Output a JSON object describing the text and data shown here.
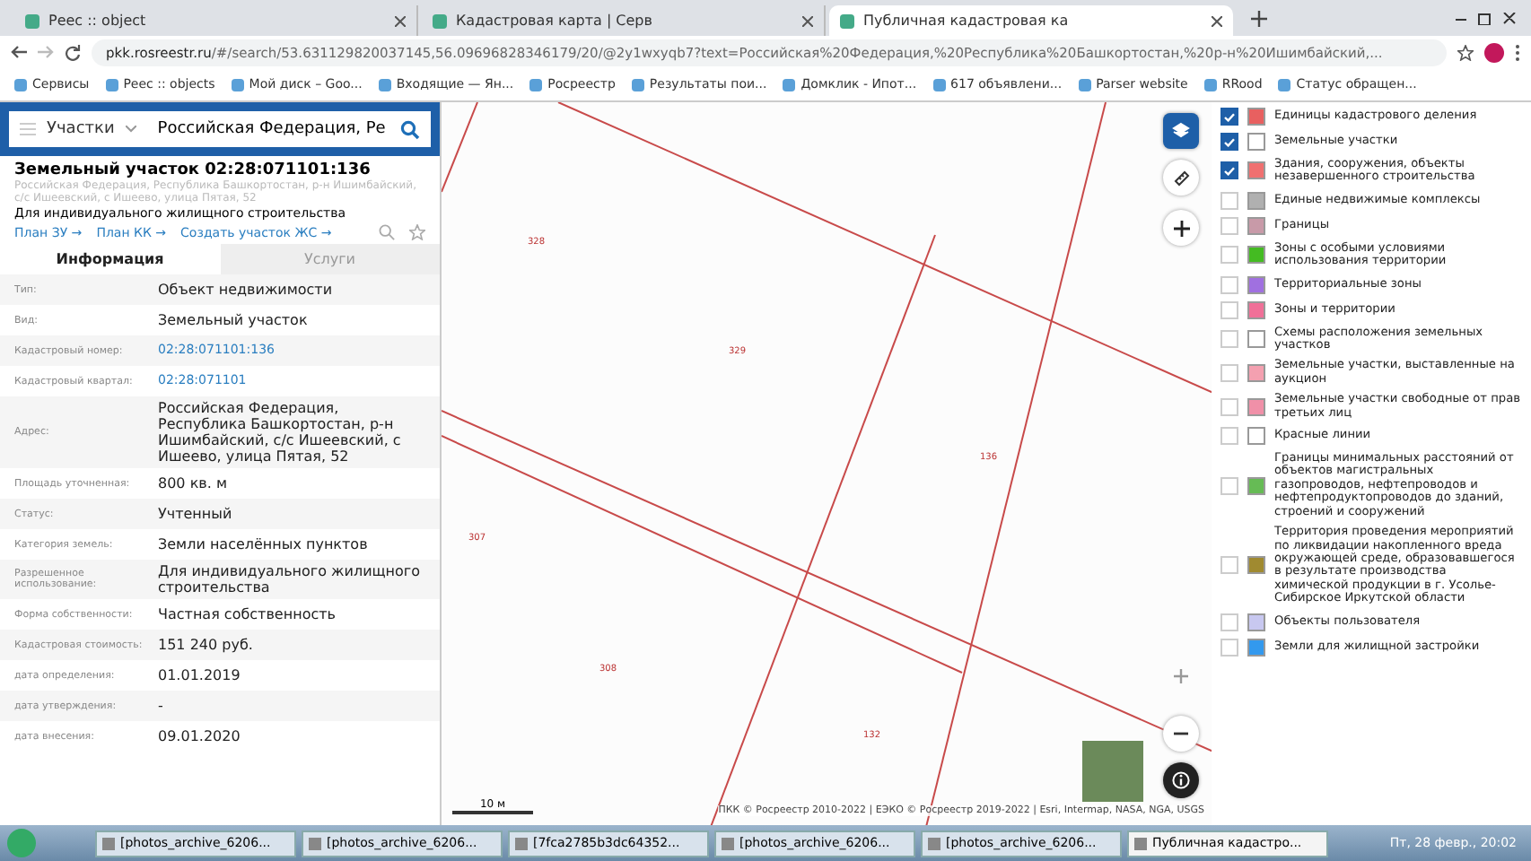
{
  "browser": {
    "tabs": [
      {
        "label": "Реес :: object",
        "selected": false
      },
      {
        "label": "Кадастровая карта | Серв",
        "selected": false
      },
      {
        "label": "Публичная кадастровая ка",
        "selected": true
      }
    ],
    "url_host": "pkk.rosreestr.ru",
    "url_path": "/#/search/53.631129820037145,56.09696828346179/20/@2y1wxyqb7?text=Российская%20Федерация,%20Республика%20Башкортостан,%20р-н%20Ишимбайский,...",
    "bookmarks": [
      "Сервисы",
      "Реес :: objects",
      "Мой диск – Goo...",
      "Входящие — Ян...",
      "Росреестр",
      "Результаты пои...",
      "Домклик - Ипот...",
      "617 объявлени...",
      "Parser website",
      "RRood",
      "Статус обращен..."
    ]
  },
  "search": {
    "category": "Участки",
    "value": "Российская Федерация, Ре"
  },
  "object": {
    "title": "Земельный участок 02:28:071101:136",
    "address": "Российская Федерация, Республика Башкортостан, р-н Ишимбайский, с/с Ишеевский, с Ишеево, улица Пятая, 52",
    "purpose": "Для индивидуального жилищного строительства",
    "links": [
      "План ЗУ →",
      "План КК →",
      "Создать участок ЖС →"
    ]
  },
  "info_tabs": [
    {
      "label": "Информация",
      "selected": true
    },
    {
      "label": "Услуги",
      "selected": false
    }
  ],
  "info_rows": [
    {
      "label": "Тип:",
      "value": "Объект недвижимости",
      "link": false
    },
    {
      "label": "Вид:",
      "value": "Земельный участок",
      "link": false
    },
    {
      "label": "Кадастровый номер:",
      "value": "02:28:071101:136",
      "link": true
    },
    {
      "label": "Кадастровый квартал:",
      "value": "02:28:071101",
      "link": true
    },
    {
      "label": "Адрес:",
      "value": "Российская Федерация, Республика Башкортостан, р-н Ишимбайский, с/с Ишеевский, с Ишеево, улица Пятая, 52",
      "link": false
    },
    {
      "label": "Площадь уточненная:",
      "value": "800 кв. м",
      "link": false
    },
    {
      "label": "Статус:",
      "value": "Учтенный",
      "link": false
    },
    {
      "label": "Категория земель:",
      "value": "Земли населённых пунктов",
      "link": false
    },
    {
      "label": "Разрешенное использование:",
      "value": "Для индивидуального жилищного строительства",
      "link": false
    },
    {
      "label": "Форма собственности:",
      "value": "Частная собственность",
      "link": false
    },
    {
      "label": "Кадастровая стоимость:",
      "value": "151 240 руб.",
      "link": false
    },
    {
      "label": "дата определения:",
      "value": "01.01.2019",
      "link": false
    },
    {
      "label": "дата утверждения:",
      "value": "-",
      "link": false
    },
    {
      "label": "дата внесения:",
      "value": "09.01.2020",
      "link": false
    }
  ],
  "map": {
    "parcels": [
      "328",
      "329",
      "136",
      "307",
      "308",
      "132"
    ],
    "scale": "10 м",
    "attribution": "ПКК © Росреестр 2010-2022 | ЕЭКО © Росреестр 2019-2022 | Esri, Intermap, NASA, NGA, USGS"
  },
  "layers": [
    {
      "label": "Единицы кадастрового деления",
      "checked": true,
      "color": "#e86060"
    },
    {
      "label": "Земельные участки",
      "checked": true,
      "color": "#ffffff"
    },
    {
      "label": "Здания, сооружения, объекты незавершенного строительства",
      "checked": true,
      "color": "#f07070"
    },
    {
      "label": "Единые недвижимые комплексы",
      "checked": false,
      "color": "#b0b0b0"
    },
    {
      "label": "Границы",
      "checked": false,
      "color": "#c89aa8"
    },
    {
      "label": "Зоны с особыми условиями использования территории",
      "checked": false,
      "color": "#44bb22"
    },
    {
      "label": "Территориальные зоны",
      "checked": false,
      "color": "#a070e0"
    },
    {
      "label": "Зоны и территории",
      "checked": false,
      "color": "#f07098"
    },
    {
      "label": "Схемы расположения земельных участков",
      "checked": false,
      "color": "#ffffff"
    },
    {
      "label": "Земельные участки, выставленные на аукцион",
      "checked": false,
      "color": "#f4a0b0"
    },
    {
      "label": "Земельные участки свободные от прав третьих лиц",
      "checked": false,
      "color": "#f090a8"
    },
    {
      "label": "Красные линии",
      "checked": false,
      "color": "#ffffff"
    },
    {
      "label": "Границы минимальных расстояний от объектов магистральных газопроводов, нефтепроводов и нефтепродуктопроводов до зданий, строений и сооружений",
      "checked": false,
      "color": "#66bb55"
    },
    {
      "label": "Территория проведения мероприятий по ликвидации накопленного вреда окружающей среде, образовавшегося в результате производства химической продукции в г. Усолье-Сибирское Иркутской области",
      "checked": false,
      "color": "#a08a30"
    },
    {
      "label": "Объекты пользователя",
      "checked": false,
      "color": "#c8c8f0"
    },
    {
      "label": "Земли для жилищной застройки",
      "checked": false,
      "color": "#3399ee"
    }
  ],
  "taskbar": {
    "items": [
      {
        "label": "[photos_archive_6206...",
        "selected": false
      },
      {
        "label": "[photos_archive_6206...",
        "selected": false
      },
      {
        "label": "[7fca2785b3dc64352...",
        "selected": false
      },
      {
        "label": "[photos_archive_6206...",
        "selected": false
      },
      {
        "label": "[photos_archive_6206...",
        "selected": false
      },
      {
        "label": "Публичная кадастро...",
        "selected": true
      }
    ],
    "clock": "Пт, 28 февр., 20:02"
  }
}
